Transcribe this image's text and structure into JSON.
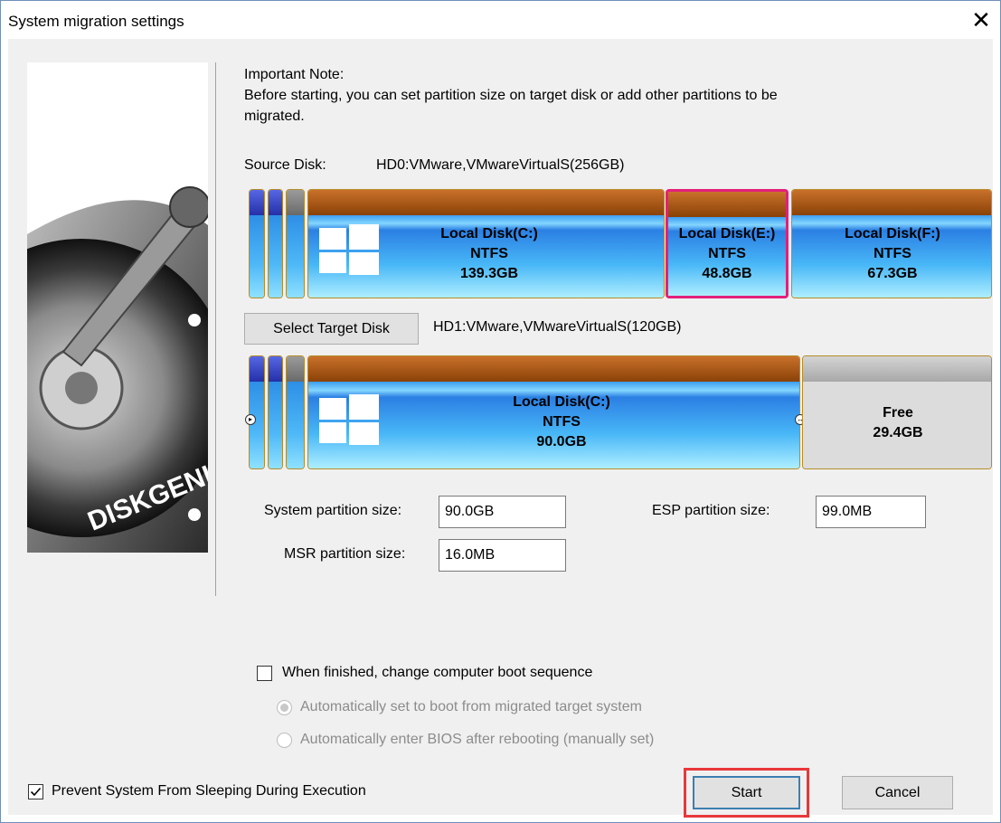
{
  "window": {
    "title": "System migration settings",
    "close_glyph": "✕"
  },
  "art": {
    "brand": "DISKGENIUS"
  },
  "note": {
    "heading": "Important Note:",
    "line1": "Before starting, you can set partition size on target disk or add other partitions to be",
    "line2": "migrated."
  },
  "source": {
    "label": "Source Disk:",
    "name": "HD0:VMware,VMwareVirtualS(256GB)",
    "partitions": [
      {
        "name": "Local Disk(C:)",
        "fs": "NTFS",
        "size": "139.3GB"
      },
      {
        "name": "Local Disk(E:)",
        "fs": "NTFS",
        "size": "48.8GB"
      },
      {
        "name": "Local Disk(F:)",
        "fs": "NTFS",
        "size": "67.3GB"
      }
    ]
  },
  "target": {
    "button": "Select Target Disk",
    "name": "HD1:VMware,VMwareVirtualS(120GB)",
    "partitions": [
      {
        "name": "Local Disk(C:)",
        "fs": "NTFS",
        "size": "90.0GB"
      },
      {
        "name": "Free",
        "size": "29.4GB"
      }
    ]
  },
  "sizes": {
    "system_label": "System partition size:",
    "system_value": "90.0GB",
    "msr_label": "MSR partition size:",
    "msr_value": "16.0MB",
    "esp_label": "ESP partition size:",
    "esp_value": "99.0MB"
  },
  "boot": {
    "checkbox_label": "When finished, change computer boot sequence",
    "checked": false,
    "option1": "Automatically set to boot from migrated target system",
    "option2": "Automatically enter BIOS after rebooting (manually set)"
  },
  "footer": {
    "prevent_sleep_label": "Prevent System From Sleeping During Execution",
    "prevent_sleep_checked": true,
    "start": "Start",
    "cancel": "Cancel"
  },
  "colors": {
    "highlight": "#e3207a",
    "start_frame": "#e8383a",
    "focus": "#3c7fb1"
  }
}
